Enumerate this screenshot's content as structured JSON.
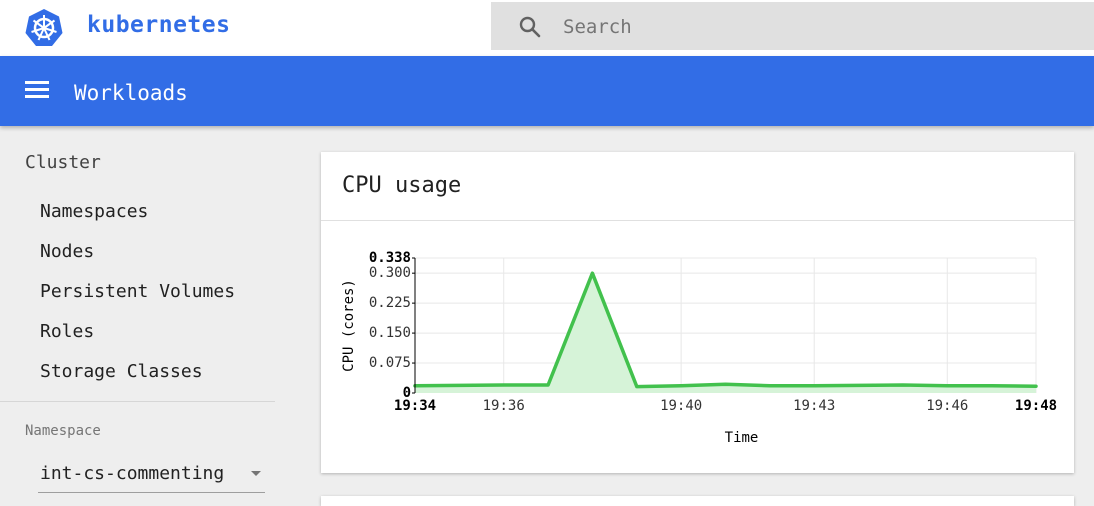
{
  "brand": {
    "name": "kubernetes",
    "logo_icon": "kubernetes-helm-icon",
    "color": "#326de6"
  },
  "search": {
    "placeholder": "Search",
    "value": ""
  },
  "header": {
    "title": "Workloads",
    "color": "#326de6"
  },
  "sidebar": {
    "section": "Cluster",
    "items": [
      {
        "label": "Namespaces"
      },
      {
        "label": "Nodes"
      },
      {
        "label": "Persistent Volumes"
      },
      {
        "label": "Roles"
      },
      {
        "label": "Storage Classes"
      }
    ],
    "namespace_label": "Namespace",
    "namespace_value": "int-cs-commenting"
  },
  "card": {
    "title": "CPU usage"
  },
  "chart_data": {
    "type": "area",
    "title": "CPU usage",
    "xlabel": "Time",
    "ylabel": "CPU (cores)",
    "x_ticks": [
      "19:34",
      "19:36",
      "19:40",
      "19:43",
      "19:46",
      "19:48"
    ],
    "y_ticks": [
      "0",
      "0.075",
      "0.150",
      "0.225",
      "0.300",
      "0.338"
    ],
    "ylim": [
      0,
      0.338
    ],
    "grid": true,
    "series_color": "#42c14d",
    "fill_color": "#d6f3d8",
    "series": [
      {
        "x": [
          "19:34",
          "19:35",
          "19:36",
          "19:37",
          "19:38",
          "19:39",
          "19:40",
          "19:41",
          "19:42",
          "19:43",
          "19:44",
          "19:45",
          "19:46",
          "19:47",
          "19:48"
        ],
        "values": [
          0.018,
          0.019,
          0.02,
          0.02,
          0.3,
          0.016,
          0.018,
          0.022,
          0.018,
          0.018,
          0.019,
          0.02,
          0.018,
          0.018,
          0.017
        ]
      }
    ]
  }
}
